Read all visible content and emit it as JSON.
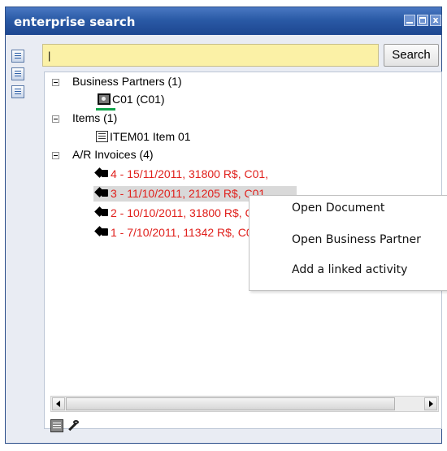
{
  "window": {
    "title": "enterprise search",
    "close_glyph": "x"
  },
  "sidebar": {
    "icons": [
      "list-view-icon",
      "person-card-icon",
      "report-icon"
    ]
  },
  "search": {
    "value": "|",
    "button_label": "Search"
  },
  "tree": {
    "groups": [
      {
        "label": "Business Partners (1)",
        "children": [
          {
            "label": "C01 (C01)",
            "icon": "business-partner-icon"
          }
        ]
      },
      {
        "label": "Items (1)",
        "children": [
          {
            "label": "ITEM01 Item 01",
            "icon": "item-icon"
          }
        ]
      },
      {
        "label": "A/R Invoices (4)",
        "children": [
          {
            "label": "4 - 15/11/2011, 31800 R$, C01,",
            "icon": "invoice-tag-icon"
          },
          {
            "label": "3 - 11/10/2011, 21205 R$, C01,",
            "icon": "invoice-tag-icon"
          },
          {
            "label": "2 - 10/10/2011, 31800 R$, C01,",
            "icon": "invoice-tag-icon"
          },
          {
            "label": "1 - 7/10/2011, 11342 R$, C01,",
            "icon": "invoice-tag-icon"
          }
        ]
      }
    ]
  },
  "context_menu": {
    "items": [
      "Open Document",
      "Open Business Partner",
      "Add a linked activity"
    ]
  },
  "footer": {
    "icons": [
      "report-tool-icon",
      "wrench-icon"
    ]
  },
  "colors": {
    "title_bar": "#2a5aa6",
    "search_field": "#fbf1a6",
    "invoice_text": "#e0201c"
  }
}
